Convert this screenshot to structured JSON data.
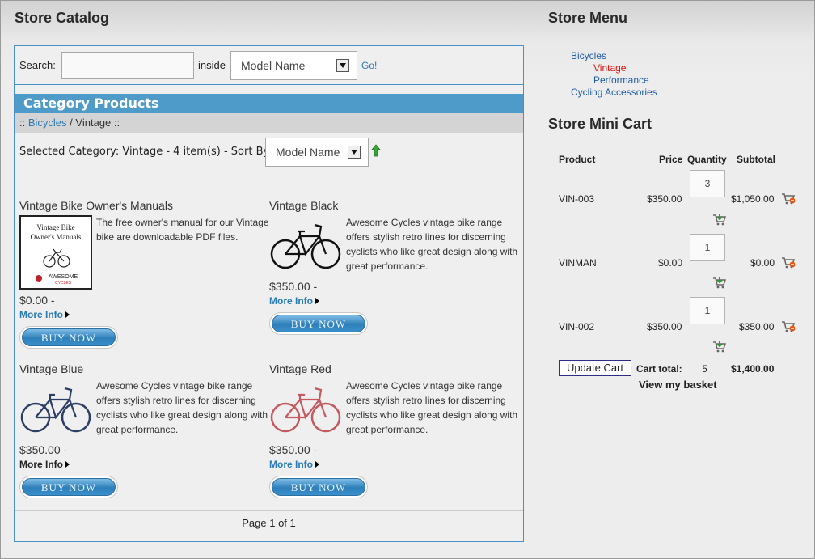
{
  "catalog": {
    "title": "Store Catalog",
    "search_label": "Search:",
    "search_value": "",
    "inside_label": "inside",
    "field_select": "Model Name",
    "go_label": "Go!",
    "category_header": "Category Products",
    "breadcrumb": {
      "prefix": "::",
      "link": "Bicycles",
      "sep": "/",
      "current": "Vintage",
      "suffix": "::"
    },
    "selected_text": "Selected Category: Vintage - 4 item(s) - Sort By:",
    "sort_select": "Model Name",
    "products": [
      {
        "name": "Vintage Bike Owner's Manuals",
        "desc": "The free owner's manual for our Vintage bike are downloadable PDF files.",
        "price": "$0.00 -",
        "more": "More Info",
        "buy": "BUY NOW",
        "thumb_text": [
          "Vintage Bike",
          "Owner's Manuals",
          "AWESOME",
          "CYCLES"
        ]
      },
      {
        "name": "Vintage Black",
        "desc": "Awesome Cycles vintage bike range offers stylish retro lines for discerning cyclists who like great design along with great performance.",
        "price": "$350.00 -",
        "more": "More Info",
        "buy": "BUY NOW",
        "bike_color": "#111111"
      },
      {
        "name": "Vintage Blue",
        "desc": "Awesome Cycles vintage bike range offers stylish retro lines for discerning cyclists who like great design along with great performance.",
        "price": "$350.00 -",
        "more": "More Info",
        "buy": "BUY NOW",
        "bike_color": "#2c3e66"
      },
      {
        "name": "Vintage Red",
        "desc": "Awesome Cycles vintage bike range offers stylish retro lines for discerning cyclists who like great design along with great performance.",
        "price": "$350.00 -",
        "more": "More Info",
        "buy": "BUY NOW",
        "bike_color": "#c45a60"
      }
    ],
    "pager": "Page 1 of 1"
  },
  "menu": {
    "title": "Store Menu",
    "items": [
      "Bicycles",
      "Vintage",
      "Performance",
      "Cycling Accessories"
    ]
  },
  "cart": {
    "title": "Store Mini Cart",
    "headers": [
      "Product",
      "Price",
      "Quantity",
      "Subtotal"
    ],
    "rows": [
      {
        "product": "VIN-003",
        "price": "$350.00",
        "qty": "3",
        "subtotal": "$1,050.00"
      },
      {
        "product": "VINMAN",
        "price": "$0.00",
        "qty": "1",
        "subtotal": "$0.00"
      },
      {
        "product": "VIN-002",
        "price": "$350.00",
        "qty": "1",
        "subtotal": "$350.00"
      }
    ],
    "update_label": "Update Cart",
    "total_label": "Cart total:",
    "total_qty": "5",
    "total_value": "$1,400.00",
    "view_basket": "View my basket"
  },
  "colors": {
    "accent": "#4e9bc9",
    "link": "#2a7ab5",
    "menu_active": "#dd1111"
  },
  "icons": [
    "dropdown-arrow-icon",
    "sort-asc-icon",
    "more-info-arrow-icon",
    "remove-from-cart-icon",
    "add-to-cart-icon"
  ]
}
